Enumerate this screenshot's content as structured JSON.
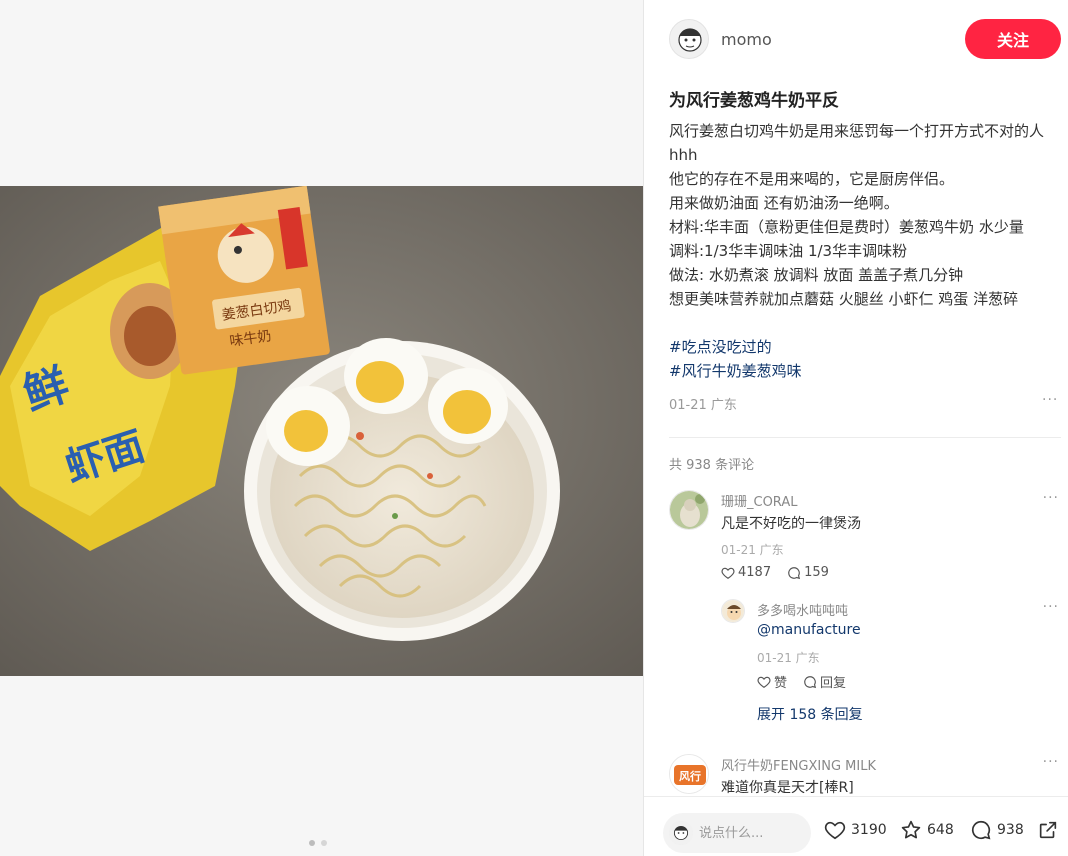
{
  "media": {
    "carousel_dot_count": 2,
    "active_dot": 1
  },
  "author": {
    "name": "momo",
    "follow_label": "关注",
    "follow_color": "#ff2442"
  },
  "post": {
    "title": "为风行姜葱鸡牛奶平反",
    "lines": [
      "风行姜葱白切鸡牛奶是用来惩罚每一个打开方式不对的人hhh",
      "他它的存在不是用来喝的，它是厨房伴侣。",
      "用来做奶油面 还有奶油汤一绝啊。",
      "材料:华丰面（意粉更佳但是费时）姜葱鸡牛奶 水少量",
      "调料:1/3华丰调味油 1/3华丰调味粉",
      "做法: 水奶煮滚 放调料 放面 盖盖子煮几分钟",
      "想更美味营养就加点蘑菇 火腿丝 小虾仁 鸡蛋 洋葱碎"
    ],
    "tags": [
      "#吃点没吃过的",
      "#风行牛奶姜葱鸡味"
    ],
    "tag_color": "#13386c",
    "date_location": "01-21 广东",
    "more_icon": "ellipsis-icon"
  },
  "comments_header": "共 938 条评论",
  "comments": [
    {
      "name": "珊珊_CORAL",
      "text": "凡是不好吃的一律煲汤",
      "meta": "01-21 广东",
      "likes": "4187",
      "replies": "159"
    },
    {
      "name": "风行牛奶FENGXING MILK",
      "text": "难道你真是天才[棒R]",
      "avatar_text": "风行"
    }
  ],
  "reply": {
    "name": "多多喝水吨吨吨",
    "text": "@manufacture",
    "meta": "01-21 广东",
    "like_label": "赞",
    "reply_label": "回复"
  },
  "expand_label": "展开 158 条回复",
  "bottom_bar": {
    "input_placeholder": "说点什么...",
    "likes": "3190",
    "collects": "648",
    "comments": "938"
  }
}
